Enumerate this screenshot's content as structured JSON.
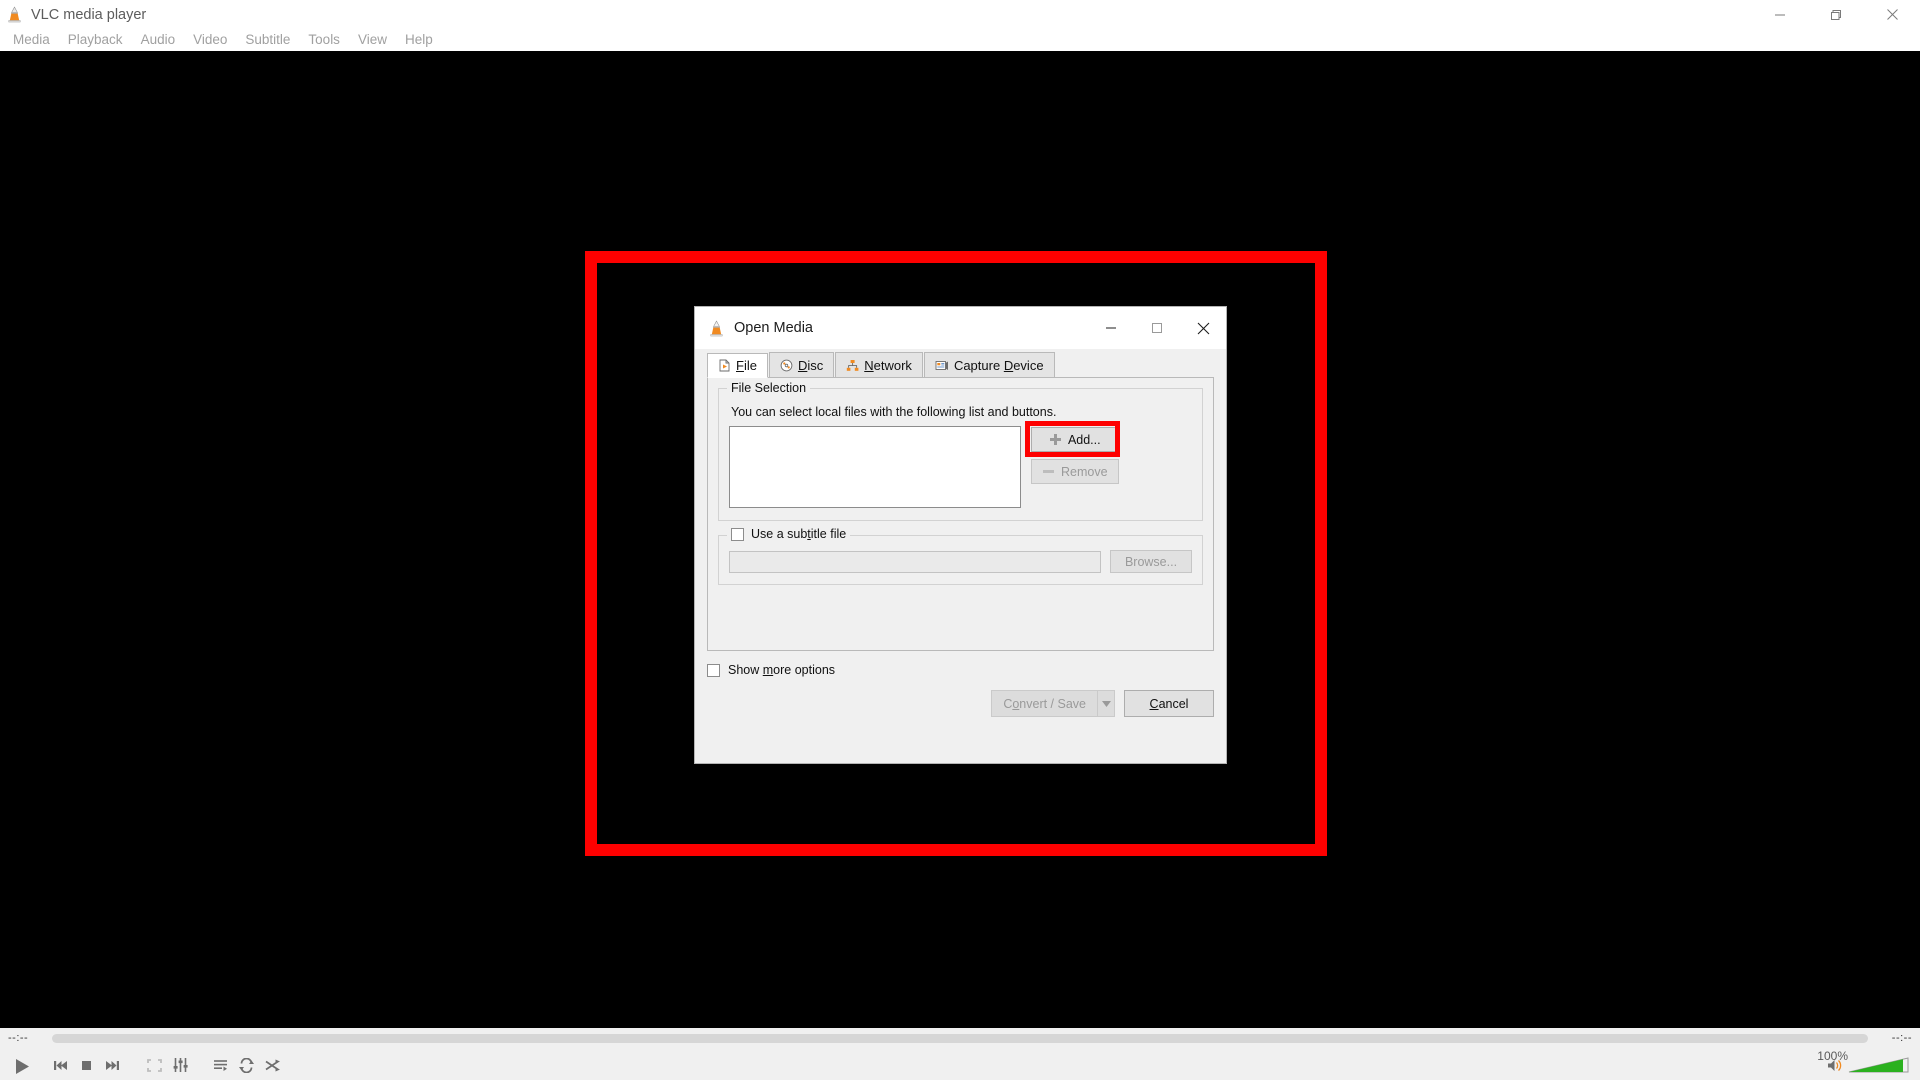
{
  "app": {
    "title": "VLC media player",
    "icon": "vlc-cone-icon"
  },
  "window_controls": {
    "minimize": "minimize-icon",
    "restore": "restore-icon",
    "close": "close-icon"
  },
  "menubar": {
    "items": [
      {
        "label": "Media"
      },
      {
        "label": "Playback"
      },
      {
        "label": "Audio"
      },
      {
        "label": "Video"
      },
      {
        "label": "Subtitle"
      },
      {
        "label": "Tools"
      },
      {
        "label": "View"
      },
      {
        "label": "Help"
      }
    ]
  },
  "dialog": {
    "title": "Open Media",
    "icon": "vlc-cone-icon",
    "controls": {
      "minimize": "minimize-icon",
      "maximize": "maximize-icon",
      "close": "close-icon"
    },
    "tabs": [
      {
        "label": "File",
        "accel": "F",
        "icon": "file-icon",
        "active": true
      },
      {
        "label": "Disc",
        "accel": "D",
        "icon": "disc-icon",
        "active": false
      },
      {
        "label": "Network",
        "accel": "N",
        "icon": "network-icon",
        "active": false
      },
      {
        "label": "Capture Device",
        "accel": "D",
        "icon": "capture-device-icon",
        "active": false
      }
    ],
    "file_selection": {
      "group_title": "File Selection",
      "description": "You can select local files with the following list and buttons.",
      "list_items": [],
      "add_label": "Add...",
      "remove_label": "Remove",
      "remove_enabled": false,
      "highlighted_button": "Add..."
    },
    "subtitle": {
      "checkbox_label": "Use a subtitle file",
      "checkbox_accel": "t",
      "checked": false,
      "path_value": "",
      "browse_label": "Browse...",
      "browse_enabled": false
    },
    "footer": {
      "show_more_label": "Show more options",
      "show_more_accel": "m",
      "show_more_checked": false,
      "convert_save_label": "Convert / Save",
      "convert_save_accel": "o",
      "convert_save_enabled": false,
      "dropdown_icon": "chevron-down-icon",
      "cancel_label": "Cancel",
      "cancel_accel": "C"
    }
  },
  "annotation": {
    "highlight_color": "#fe0000",
    "outer_box": "dialog-region-highlight",
    "inner_box": "add-button-highlight"
  },
  "playback_bar": {
    "elapsed_time": "--:--",
    "total_time": "--:--",
    "progress_percent": 0,
    "controls": [
      {
        "name": "play-button",
        "icon": "play-icon",
        "enabled": true
      },
      {
        "name": "previous-button",
        "icon": "previous-icon",
        "enabled": true
      },
      {
        "name": "stop-button",
        "icon": "stop-icon",
        "enabled": true
      },
      {
        "name": "next-button",
        "icon": "next-icon",
        "enabled": true
      },
      {
        "name": "fullscreen-button",
        "icon": "fullscreen-icon",
        "enabled": false
      },
      {
        "name": "extended-settings-button",
        "icon": "equalizer-icon",
        "enabled": true
      },
      {
        "name": "playlist-button",
        "icon": "playlist-icon",
        "enabled": true
      },
      {
        "name": "loop-button",
        "icon": "loop-icon",
        "enabled": true
      },
      {
        "name": "shuffle-button",
        "icon": "shuffle-icon",
        "enabled": true
      }
    ],
    "volume": {
      "label": "100%",
      "value": 100,
      "icon": "speaker-icon",
      "fill_color": "#2bb11f"
    }
  }
}
